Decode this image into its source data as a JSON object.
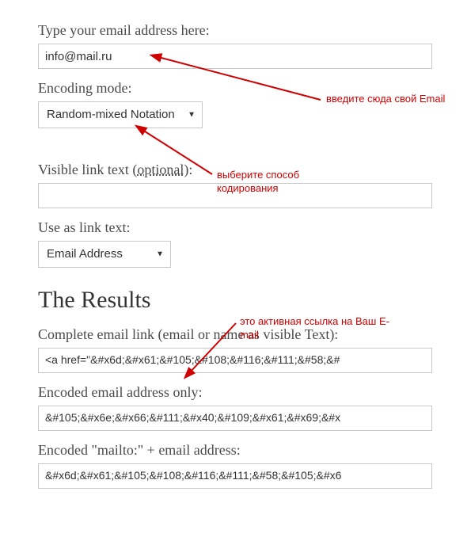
{
  "form": {
    "email_label": "Type your email address here:",
    "email_value": "info@mail.ru",
    "encoding_label": "Encoding mode:",
    "encoding_selected": "Random-mixed Notation",
    "visible_text_label_pre": "Visible link text (",
    "visible_text_label_opt": "optional",
    "visible_text_label_post": "):",
    "visible_text_value": "",
    "linktext_label": "Use as link text:",
    "linktext_selected": "Email Address"
  },
  "results": {
    "heading": "The Results",
    "complete_label": "Complete email link (email or name as visible Text):",
    "complete_value": "<a href=\"&#x6d;&#x61;&#105;&#108;&#116;&#111;&#58;&#",
    "encoded_email_label": "Encoded email address only:",
    "encoded_email_value": "&#105;&#x6e;&#x66;&#111;&#x40;&#109;&#x61;&#x69;&#x",
    "mailto_label": "Encoded \"mailto:\" + email address:",
    "mailto_value": "&#x6d;&#x61;&#105;&#108;&#116;&#111;&#58;&#105;&#x6"
  },
  "annotations": {
    "a1": "введите сюда свой Email",
    "a2": "выберите способ кодирования",
    "a3": "это активная ссылка на Ваш E-mail"
  },
  "colors": {
    "annotation": "#d10000",
    "label": "#4a4a4a",
    "border": "#c8c8c8"
  }
}
